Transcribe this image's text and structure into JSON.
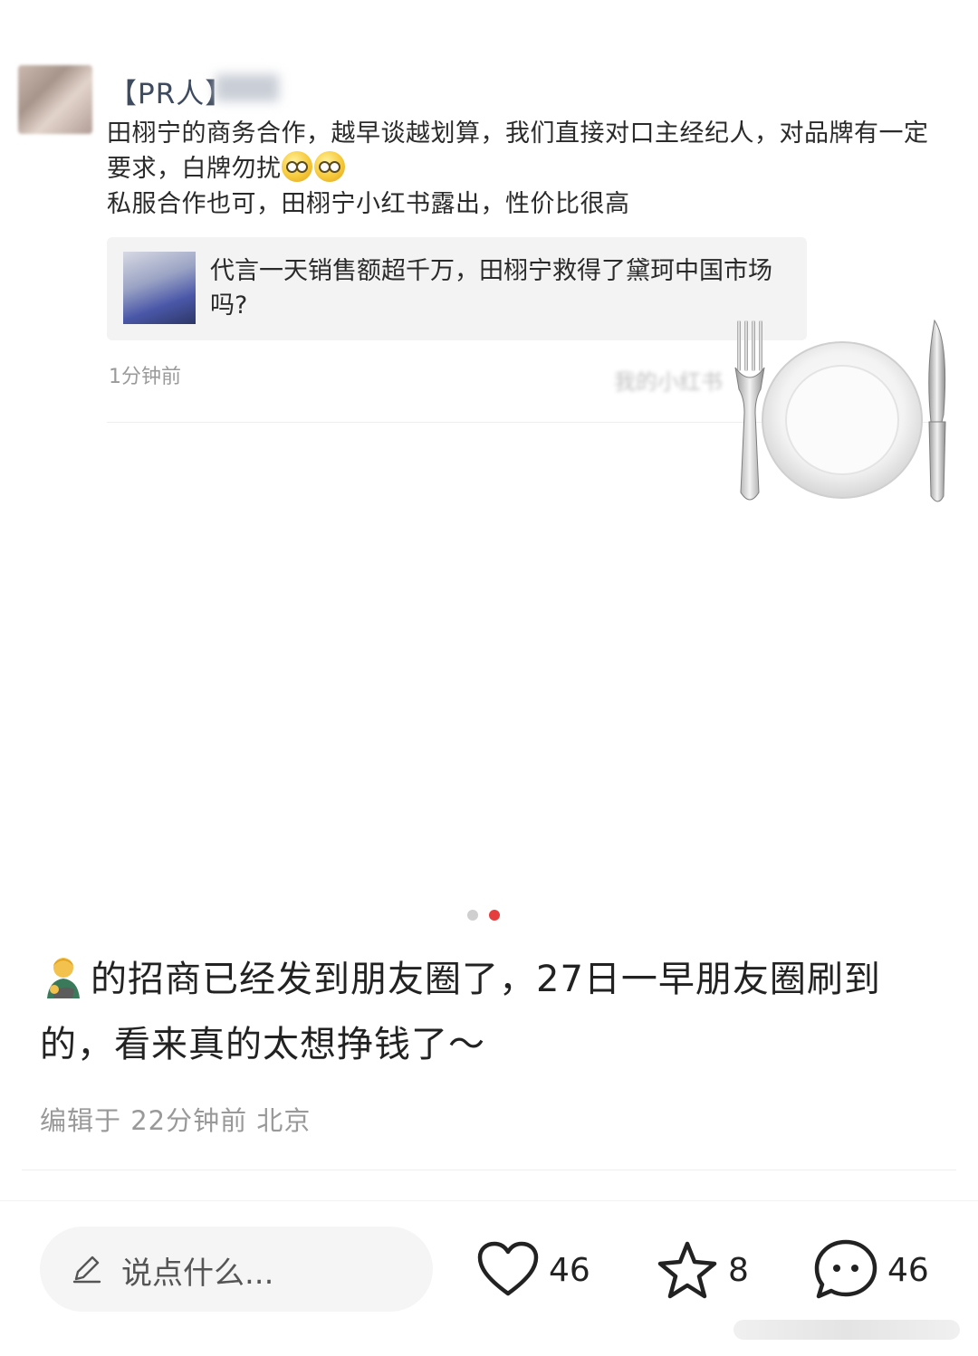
{
  "screenshot": {
    "username": "【PR人】",
    "message_lines": [
      "田栩宁的商务合作，越早谈越划算，我们直接对口主经纪人，对品牌有一定要求，白牌勿扰",
      "私服合作也可，田栩宁小红书露出，性价比很高"
    ],
    "quote_text": "代言一天销售额超千万，田栩宁救得了黛珂中国市场吗?",
    "time": "1分钟前",
    "source": "我的小红书"
  },
  "caption": {
    "text": "的招商已经发到朋友圈了，27日一早朋友圈刷到的，看来真的太想挣钱了～"
  },
  "meta": {
    "edited": "编辑于 22分钟前 北京"
  },
  "bottom_bar": {
    "comment_placeholder": "说点什么...",
    "likes": "46",
    "collects": "8",
    "comments": "46"
  },
  "icons": [
    "person-emoji-icon",
    "eyes-emoji-icon",
    "plate-cutlery-icon",
    "pencil-icon",
    "heart-icon",
    "star-icon",
    "comment-bubble-icon"
  ],
  "colors": {
    "accent": "#e53d3d",
    "muted": "#999999"
  }
}
